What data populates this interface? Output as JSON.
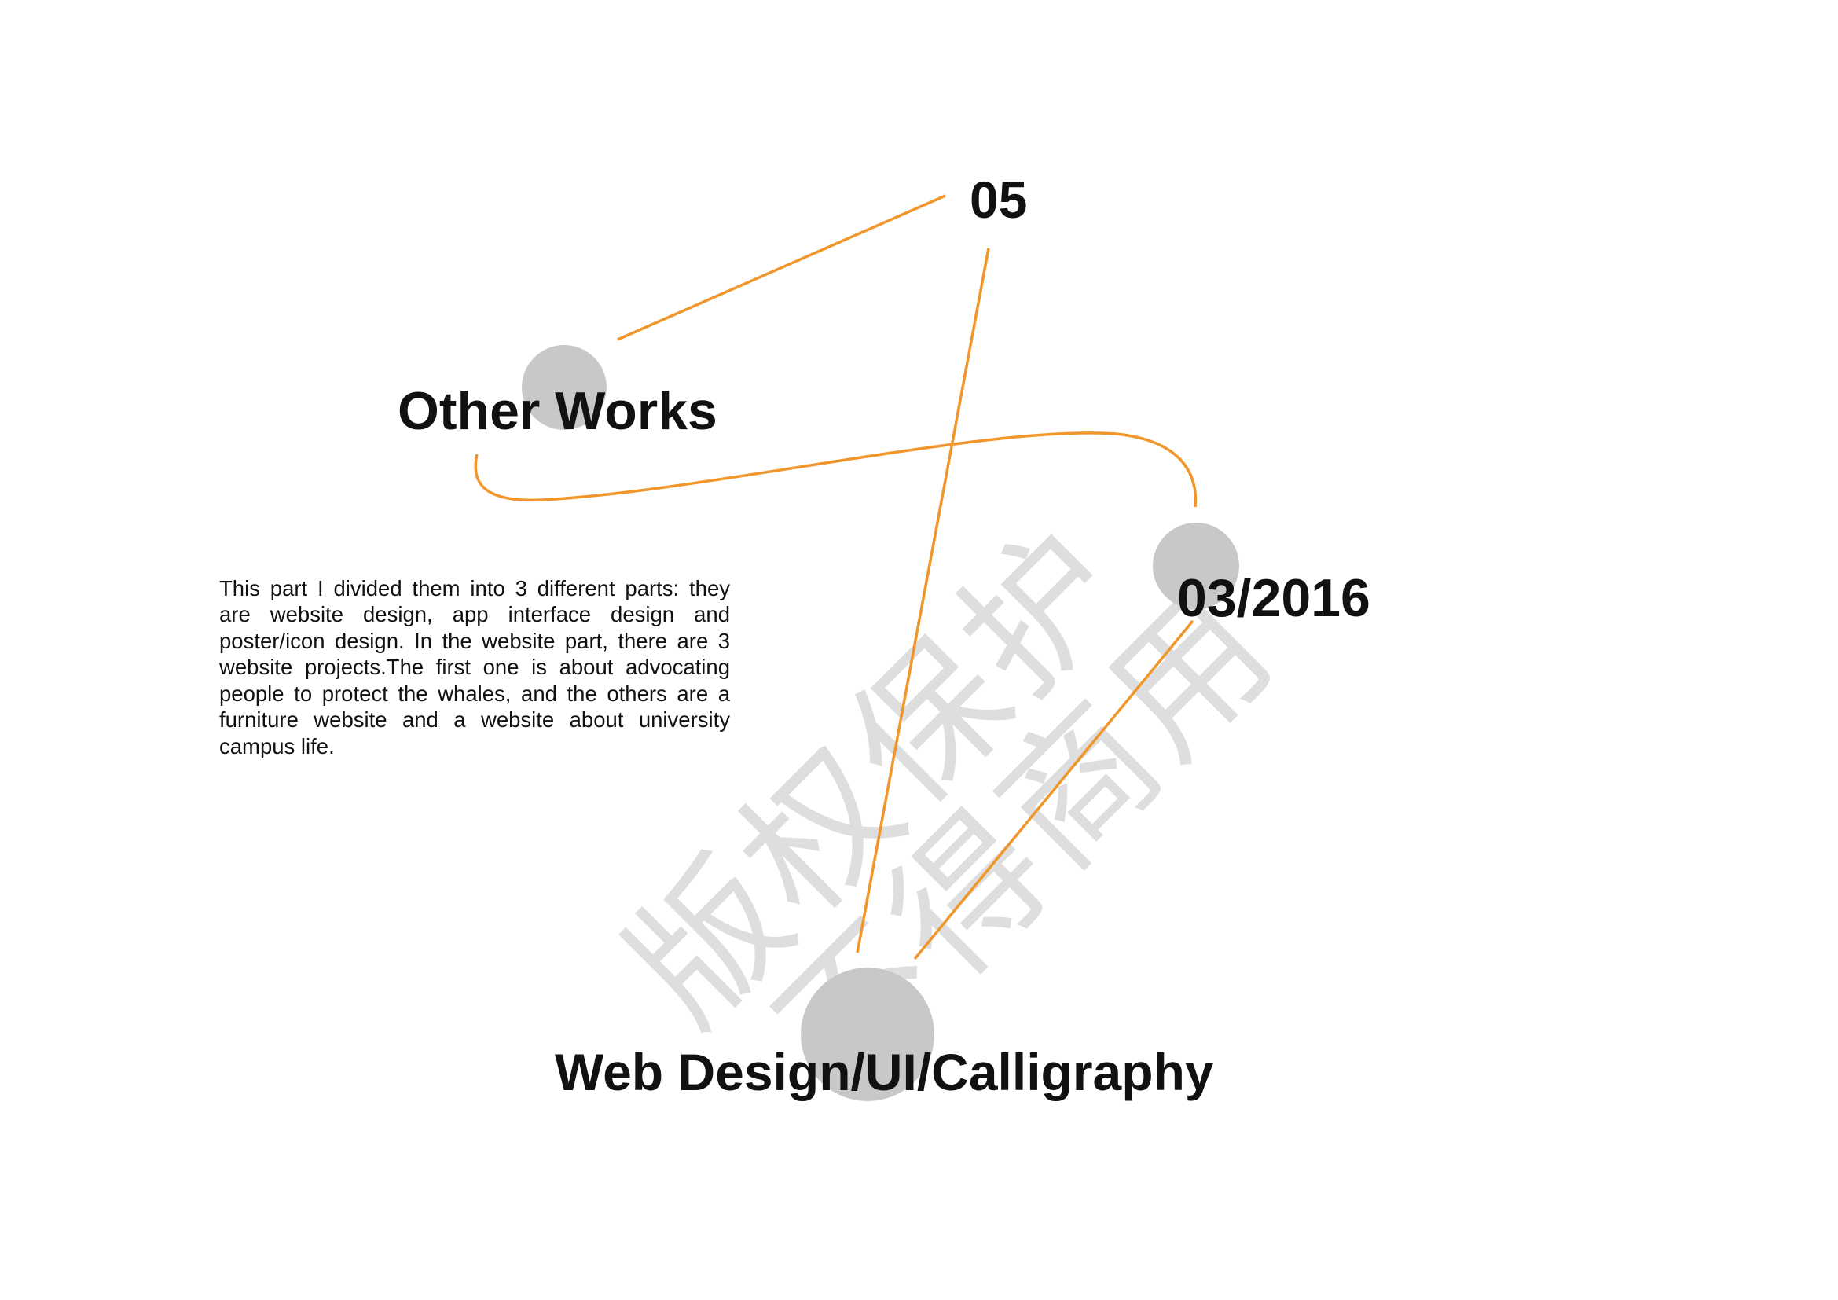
{
  "header": {
    "section_number": "05",
    "date": "03/2016"
  },
  "main": {
    "title": "Other Works",
    "subtitle": "Web Design/UI/Calligraphy",
    "description": "This part I divided them into 3 different parts: they are website design, app interface design and poster/icon design. In the website part, there are 3 website projects.The first one is about advocating people to protect the whales, and the others are a furniture website and a website about university campus life."
  },
  "watermark": {
    "line1": "版权保护",
    "line2": "不得商用"
  },
  "colors": {
    "accent_line": "#f0962a",
    "circle_fill": "#c8c8c8",
    "text": "#111111",
    "watermark": "#d9d9d9"
  }
}
